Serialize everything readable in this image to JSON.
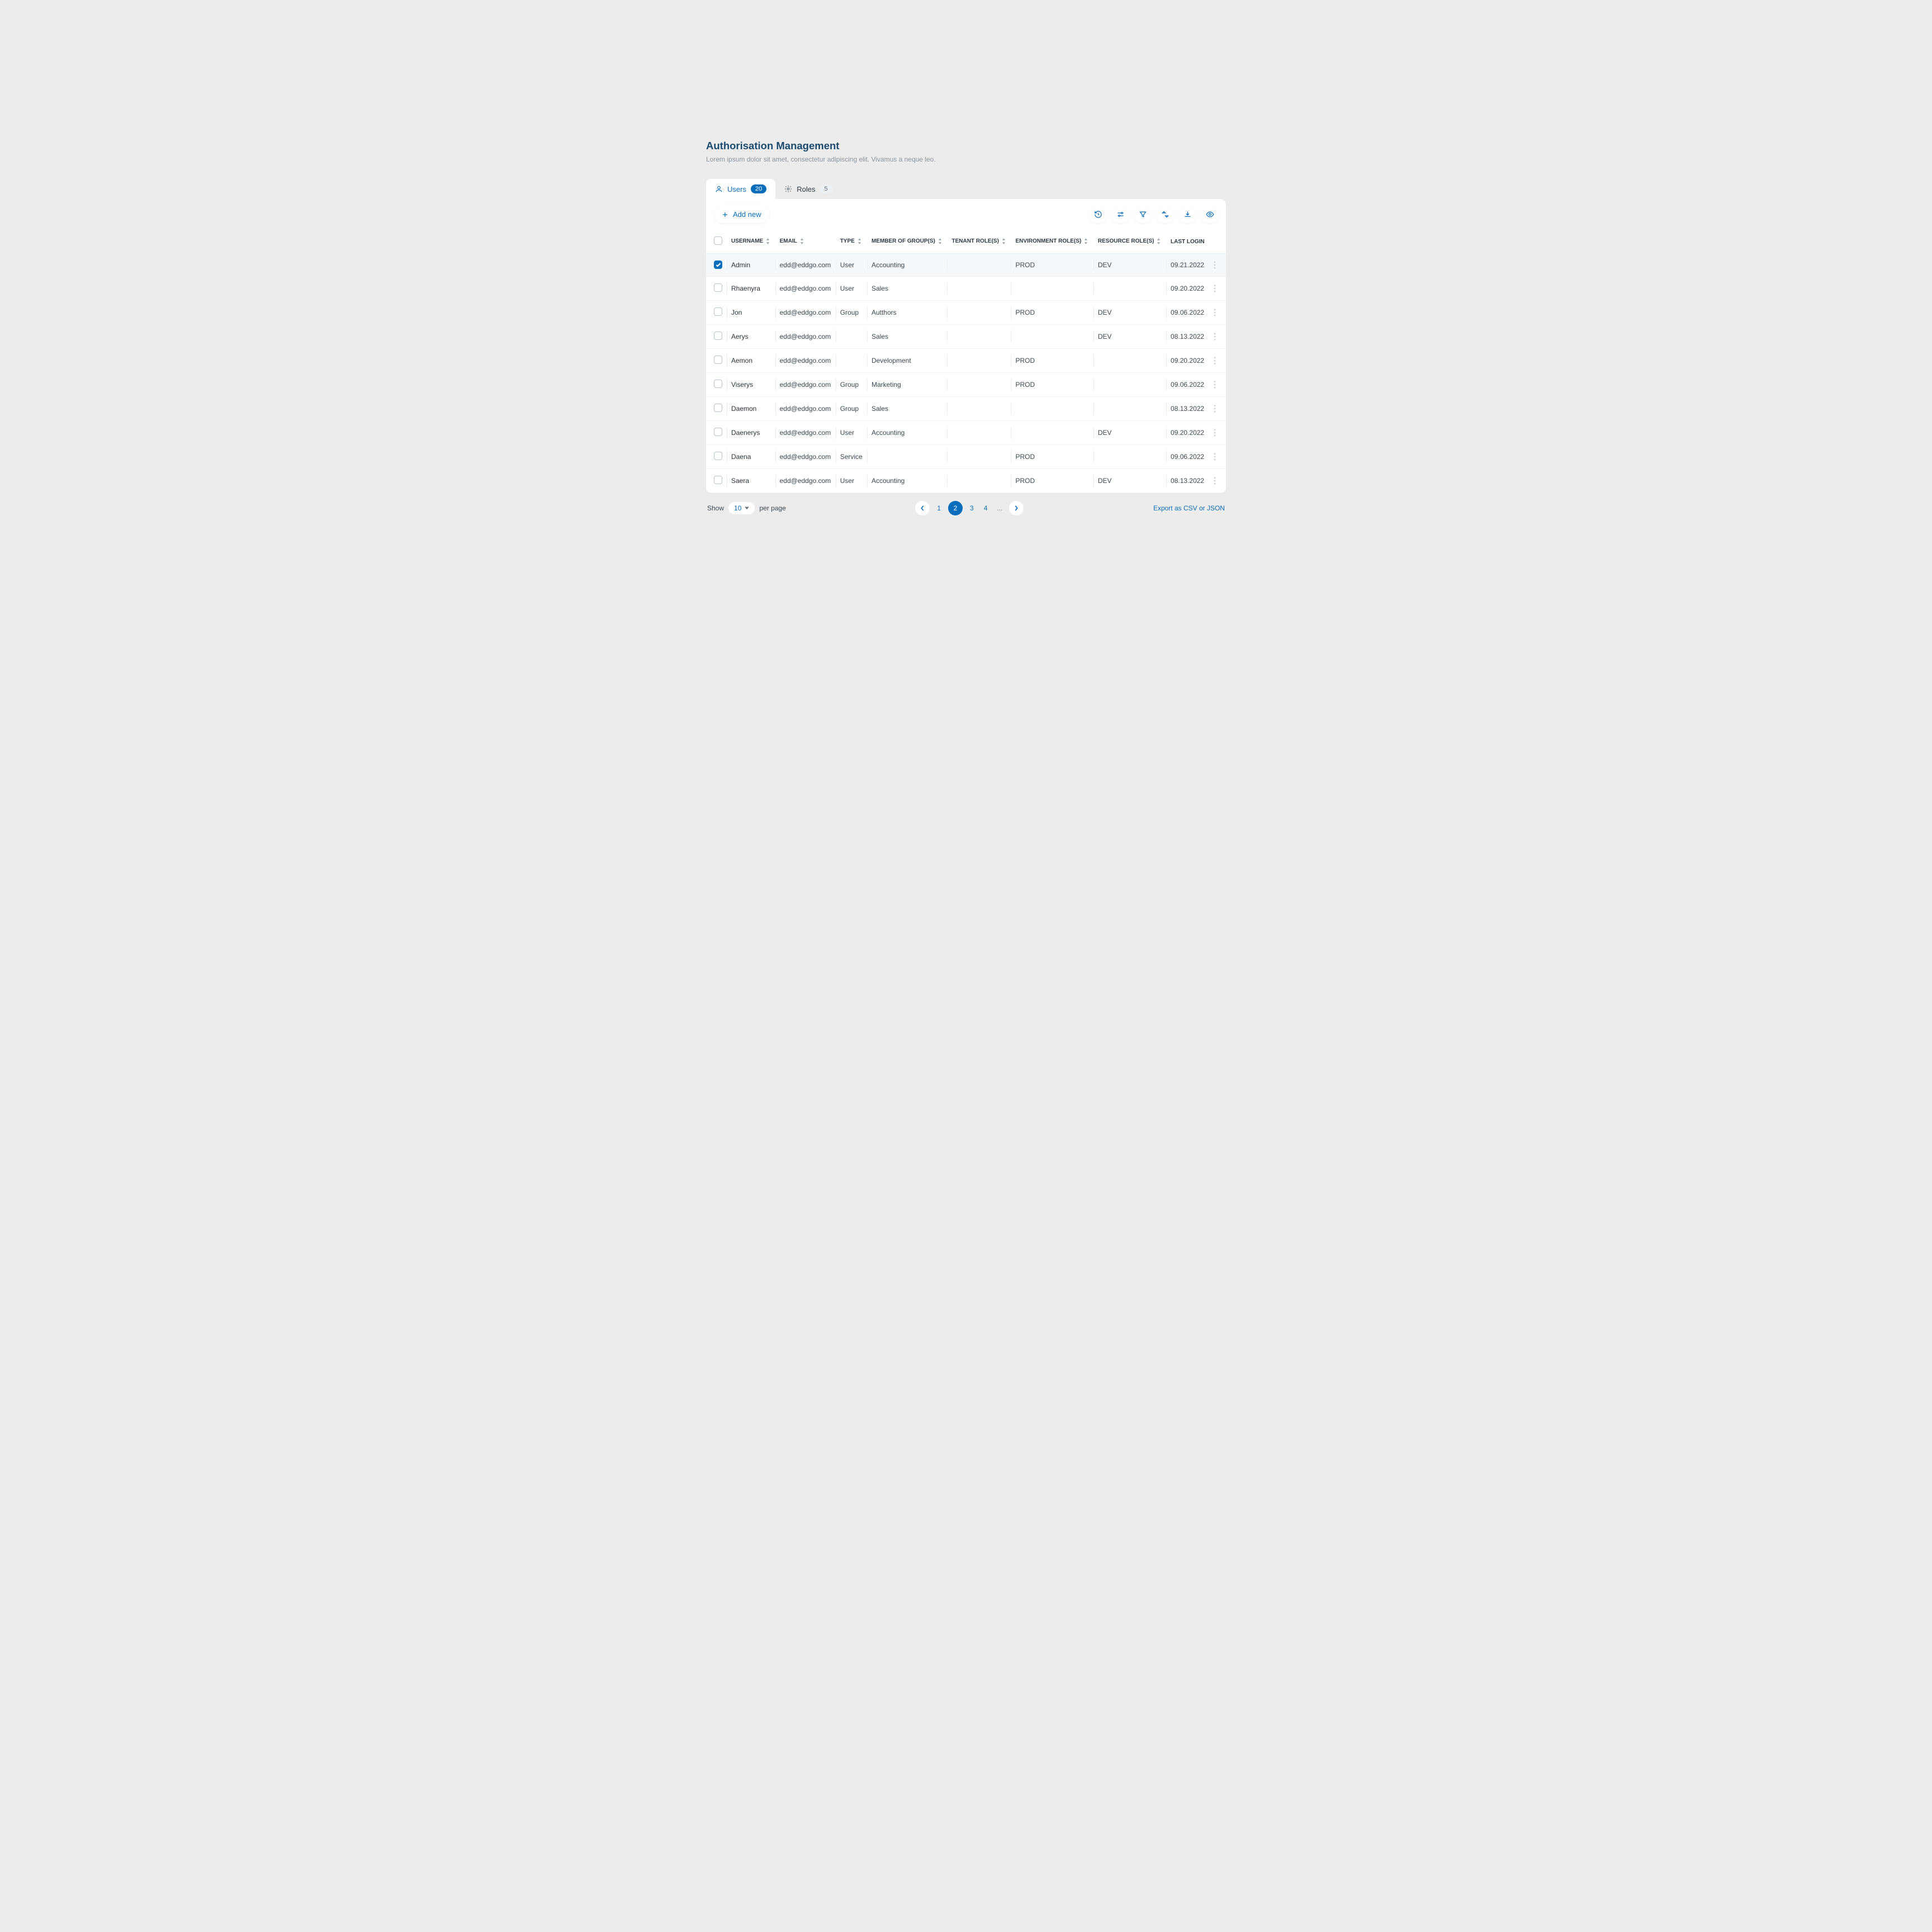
{
  "header": {
    "title": "Authorisation Management",
    "subtitle": "Lorem ipsum dolor sit amet, consectetur adipiscing elit. Vivamus a neque leo."
  },
  "tabs": {
    "users": {
      "label": "Users",
      "count": "20"
    },
    "roles": {
      "label": "Roles",
      "count": "5"
    }
  },
  "toolbar": {
    "add_new": "Add new"
  },
  "columns": {
    "username": "USERNAME",
    "email": "EMAIL",
    "type": "TYPE",
    "groups": "MEMBER OF GROUP(S)",
    "tenant": "TENANT ROLE(S)",
    "env": "ENVIRONMENT ROLE(S)",
    "resource": "RESOURCE ROLE(S)",
    "last_login": "LAST LOGIN"
  },
  "rows": [
    {
      "selected": true,
      "username": "Admin",
      "email": "edd@eddgo.com",
      "type": "User",
      "groups": "Accounting",
      "tenant": "",
      "env": "PROD",
      "resource": "DEV",
      "last_login": "09.21.2022"
    },
    {
      "selected": false,
      "username": "Rhaenyra",
      "email": "edd@eddgo.com",
      "type": "User",
      "groups": "Sales",
      "tenant": "",
      "env": "",
      "resource": "",
      "last_login": "09.20.2022"
    },
    {
      "selected": false,
      "username": "Jon",
      "email": "edd@eddgo.com",
      "type": "Group",
      "groups": "Autthors",
      "tenant": "",
      "env": "PROD",
      "resource": "DEV",
      "last_login": "09.06.2022"
    },
    {
      "selected": false,
      "username": "Aerys",
      "email": "edd@eddgo.com",
      "type": "",
      "groups": "Sales",
      "tenant": "",
      "env": "",
      "resource": "DEV",
      "last_login": "08.13.2022"
    },
    {
      "selected": false,
      "username": "Aemon",
      "email": "edd@eddgo.com",
      "type": "",
      "groups": "Development",
      "tenant": "",
      "env": "PROD",
      "resource": "",
      "last_login": "09.20.2022"
    },
    {
      "selected": false,
      "username": "Viserys",
      "email": "edd@eddgo.com",
      "type": "Group",
      "groups": "Marketing",
      "tenant": "",
      "env": "PROD",
      "resource": "",
      "last_login": "09.06.2022"
    },
    {
      "selected": false,
      "username": "Daemon",
      "email": "edd@eddgo.com",
      "type": "Group",
      "groups": "Sales",
      "tenant": "",
      "env": "",
      "resource": "",
      "last_login": "08.13.2022"
    },
    {
      "selected": false,
      "username": "Daenerys",
      "email": "edd@eddgo.com",
      "type": "User",
      "groups": "Accounting",
      "tenant": "",
      "env": "",
      "resource": "DEV",
      "last_login": "09.20.2022"
    },
    {
      "selected": false,
      "username": "Daena",
      "email": "edd@eddgo.com",
      "type": "Service",
      "groups": "",
      "tenant": "",
      "env": "PROD",
      "resource": "",
      "last_login": "09.06.2022"
    },
    {
      "selected": false,
      "username": "Saera",
      "email": "edd@eddgo.com",
      "type": "User",
      "groups": "Accounting",
      "tenant": "",
      "env": "PROD",
      "resource": "DEV",
      "last_login": "08.13.2022"
    }
  ],
  "footer": {
    "show": "Show",
    "per_page": "per page",
    "page_size": "10",
    "pages": [
      "1",
      "2",
      "3",
      "4"
    ],
    "active_page": "2",
    "ellipsis": "...",
    "export": "Export as CSV or JSON"
  }
}
